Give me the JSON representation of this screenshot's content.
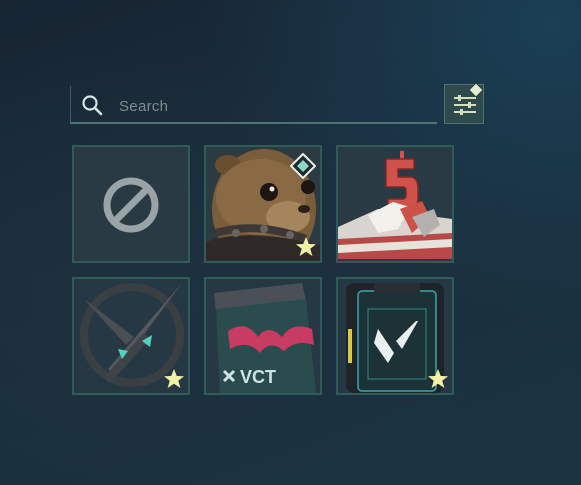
{
  "search": {
    "placeholder": "Search",
    "value": ""
  },
  "filter": {
    "icon": "sliders-icon",
    "badge_icon": "diamond-badge-icon"
  },
  "items": [
    {
      "name": "none",
      "icon": "prohibited-icon",
      "favorite": false
    },
    {
      "name": "otter",
      "icon": "otter-icon",
      "favorite": true,
      "badge": "diamond-badge"
    },
    {
      "name": "birthday-cake",
      "icon": "cake-5-icon",
      "favorite": false
    },
    {
      "name": "knife-emblem",
      "icon": "knife-emblem-icon",
      "favorite": true
    },
    {
      "name": "vct-cup",
      "icon": "vct-cup-icon",
      "favorite": false
    },
    {
      "name": "valorant-card",
      "icon": "valorant-card-icon",
      "favorite": true
    }
  ],
  "colors": {
    "star": "#f3f0a8",
    "tile_border": "#2f5b58",
    "accent": "#8fd6c6"
  }
}
